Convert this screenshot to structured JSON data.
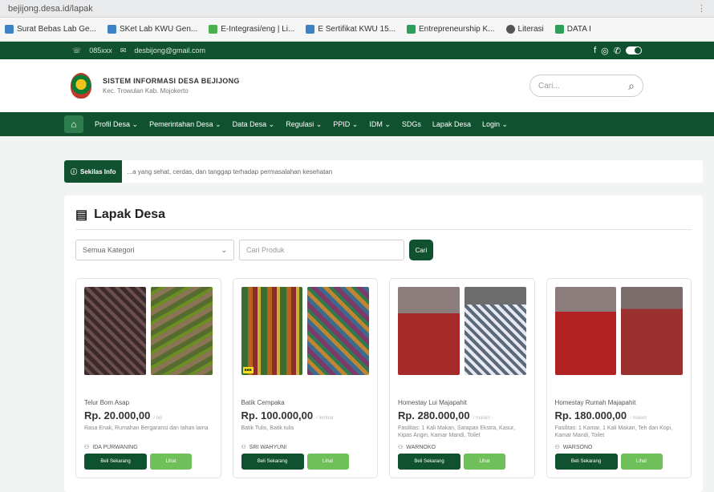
{
  "browser": {
    "url": "bejijong.desa.id/lapak",
    "bookmarks": [
      {
        "label": "Surat Bebas Lab Ge...",
        "color": "#3b82c4"
      },
      {
        "label": "SKet Lab KWU Gen...",
        "color": "#3b82c4"
      },
      {
        "label": "E-Integrasi/eng | Li...",
        "color": "#4caf50"
      },
      {
        "label": "E Sertifikat KWU 15...",
        "color": "#3b82c4"
      },
      {
        "label": "Entrepreneurship K...",
        "color": "#2e9e5b"
      },
      {
        "label": "Literasi",
        "color": "#555555"
      },
      {
        "label": "DATA I",
        "color": "#2e9e5b"
      }
    ]
  },
  "topbar": {
    "phone": "085xxx",
    "email": "desbijong@gmail.com"
  },
  "header": {
    "title": "SISTEM INFORMASI DESA BEJIJONG",
    "subtitle": "Kec. Trowulan Kab. Mojokerto",
    "search_placeholder": "Cari..."
  },
  "nav": {
    "items": [
      "Profil Desa ⌄",
      "Pemerintahan Desa ⌄",
      "Data Desa ⌄",
      "Regulasi ⌄",
      "PPID ⌄",
      "IDM ⌄",
      "SDGs",
      "Lapak Desa",
      "Login ⌄"
    ]
  },
  "info": {
    "label": "Sekilas Info",
    "text": "...a yang sehat, cerdas, dan tanggap terhadap permasalahan kesehatan"
  },
  "lapak": {
    "title": "Lapak Desa",
    "category_select": "Semua Kategori",
    "search_placeholder": "Cari Produk",
    "search_button": "Cari",
    "buy_label": "Beli Sekarang",
    "detail_label": "Lihat",
    "products": [
      {
        "name": "Telur Bom Asap",
        "price": "Rp. 20.000,00",
        "unit": "/ biji",
        "desc": "Rasa Enak, Rumahan Bergaransi dan tahan lama",
        "seller": "IDA PURWANING"
      },
      {
        "name": "Batik Cempaka",
        "price": "Rp. 100.000,00",
        "unit": "/ lembar",
        "desc": "Batik Tulis, Batik tulis",
        "seller": "SRI WAHYUNI"
      },
      {
        "name": "Homestay Lui Majapahit",
        "price": "Rp. 280.000,00",
        "unit": "/ malam",
        "desc": "Fasilitas: 1 Kali Makan, Sarapan Ekstra, Kasur, Kipas Angin, Kamar Mandi, Toilet",
        "seller": "WARNOKO"
      },
      {
        "name": "Homestay Rumah Majapahit",
        "price": "Rp. 180.000,00",
        "unit": "/ malam",
        "desc": "Fasilitas: 1 Kamar, 1 Kali Makan, Teh dan Kopi, Kamar Mandi, Toilet",
        "seller": "WARSONO"
      }
    ]
  }
}
